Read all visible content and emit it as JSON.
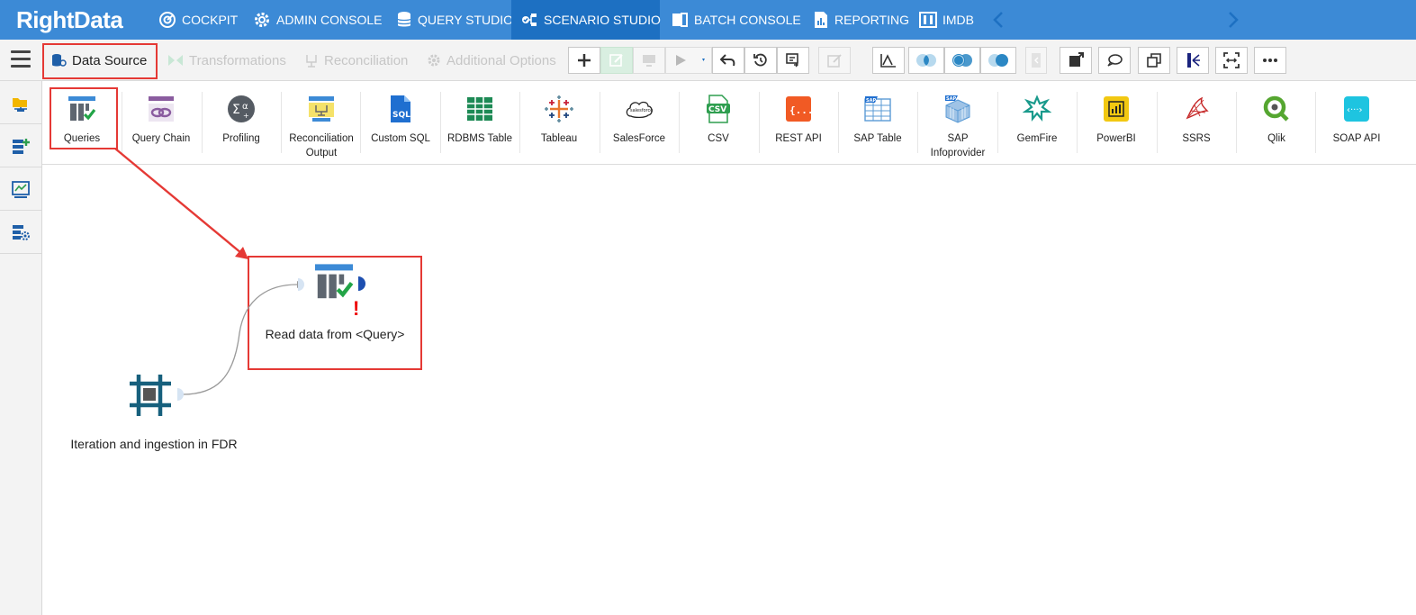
{
  "brand": {
    "logo_text": "RightData",
    "color": "#3c8ad6",
    "active_color": "#1d70c2"
  },
  "top_nav": {
    "items": [
      {
        "label": "COCKPIT",
        "icon": "cockpit-icon"
      },
      {
        "label": "ADMIN CONSOLE",
        "icon": "gear-icon"
      },
      {
        "label": "QUERY STUDIO",
        "icon": "database-icon"
      },
      {
        "label": "SCENARIO STUDIO",
        "icon": "scenario-icon",
        "active": true
      },
      {
        "label": "BATCH CONSOLE",
        "icon": "batch-icon"
      },
      {
        "label": "REPORTING",
        "icon": "report-icon"
      },
      {
        "label": "IMDB",
        "icon": "imdb-icon"
      }
    ],
    "prev_icon": "chevron-left-icon",
    "next_icon": "chevron-right-icon"
  },
  "toolbar": {
    "tabs": [
      {
        "label": "Data Source",
        "state": "active",
        "icon": "data-source-icon"
      },
      {
        "label": "Transformations",
        "state": "disabled",
        "icon": "transform-icon"
      },
      {
        "label": "Reconciliation",
        "state": "disabled",
        "icon": "reconciliation-icon"
      },
      {
        "label": "Additional Options",
        "state": "disabled",
        "icon": "gear-icon"
      }
    ]
  },
  "palette": {
    "items": [
      {
        "label": "Queries",
        "icon": "queries-icon"
      },
      {
        "label": "Query Chain",
        "icon": "query-chain-icon"
      },
      {
        "label": "Profiling",
        "icon": "profiling-icon"
      },
      {
        "label": "Reconciliation Output",
        "icon": "reconciliation-output-icon"
      },
      {
        "label": "Custom SQL",
        "icon": "sql-icon"
      },
      {
        "label": "RDBMS Table",
        "icon": "table-icon"
      },
      {
        "label": "Tableau",
        "icon": "tableau-icon"
      },
      {
        "label": "SalesForce",
        "icon": "salesforce-icon"
      },
      {
        "label": "CSV",
        "icon": "csv-icon"
      },
      {
        "label": "REST API",
        "icon": "rest-api-icon"
      },
      {
        "label": "SAP Table",
        "icon": "sap-table-icon"
      },
      {
        "label": "SAP Infoprovider",
        "icon": "sap-infoprovider-icon"
      },
      {
        "label": "GemFire",
        "icon": "gemfire-icon"
      },
      {
        "label": "PowerBI",
        "icon": "powerbi-icon"
      },
      {
        "label": "SSRS",
        "icon": "ssrs-icon"
      },
      {
        "label": "Qlik",
        "icon": "qlik-icon"
      },
      {
        "label": "SOAP API",
        "icon": "soap-api-icon"
      }
    ],
    "icon_text": {
      "sql": "SQL",
      "csv": "CSV",
      "sap": "SAP",
      "salesforce": "salesforce",
      "rest": "{...}",
      "soap": "‹···›"
    }
  },
  "canvas": {
    "nodes": [
      {
        "label": "Read data from <Query>",
        "icon": "queries-icon",
        "warning": "!"
      },
      {
        "label": "Iteration and ingestion in FDR",
        "icon": "iteration-icon"
      }
    ]
  }
}
